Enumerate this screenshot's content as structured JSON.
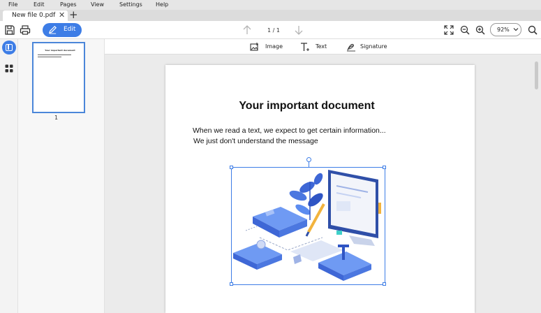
{
  "menu": [
    "File",
    "Edit",
    "Pages",
    "View",
    "Settings",
    "Help"
  ],
  "tab": {
    "title": "New file 0.pdf",
    "close": "✕",
    "new_tab": "+"
  },
  "toolbar": {
    "edit_label": "Edit",
    "page_indicator": "1 / 1",
    "zoom_value": "92%"
  },
  "edit_tools": {
    "image": "Image",
    "text": "Text",
    "signature": "Signature"
  },
  "thumbnail": {
    "page_number": "1",
    "title": "Your important document"
  },
  "document": {
    "title": "Your important document",
    "line1": "When we read a text, we expect to get certain information...",
    "line2": "We just don't understand the message"
  },
  "colors": {
    "accent": "#3d7de6",
    "illustration_blue": "#5b8cf0"
  }
}
